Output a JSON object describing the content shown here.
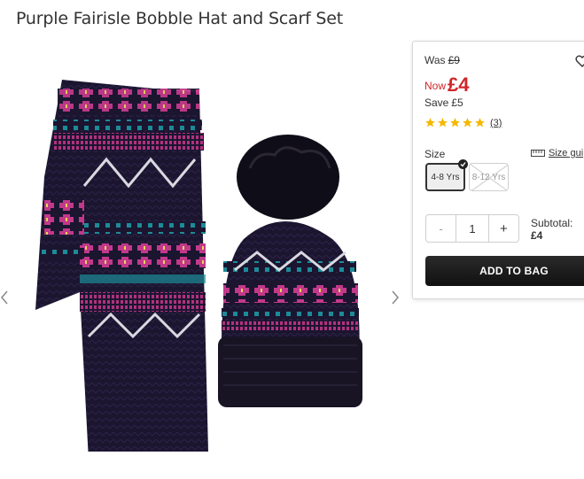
{
  "product": {
    "title": "Purple Fairisle Bobble Hat and Scarf Set",
    "image_alt_icons": [
      "scarf-image",
      "hat-image"
    ]
  },
  "price": {
    "was_label": "Was",
    "was_amount": "£9",
    "now_label": "Now",
    "now_amount": "£4",
    "save_label": "Save",
    "save_amount": "£5",
    "now_color": "#d0262a"
  },
  "rating": {
    "stars": 5,
    "count_text": "(3)",
    "star_color": "#f5b800"
  },
  "size": {
    "label": "Size",
    "guide_label": "Size gui",
    "options": [
      {
        "label": "4-8 Yrs",
        "selected": true,
        "available": true
      },
      {
        "label": "8-12 Yrs",
        "selected": false,
        "available": false
      }
    ]
  },
  "quantity": {
    "minus": "-",
    "value": "1",
    "plus": "+"
  },
  "subtotal": {
    "label": "Subtotal:",
    "value": "£4"
  },
  "cart": {
    "add_label": "ADD TO BAG"
  }
}
